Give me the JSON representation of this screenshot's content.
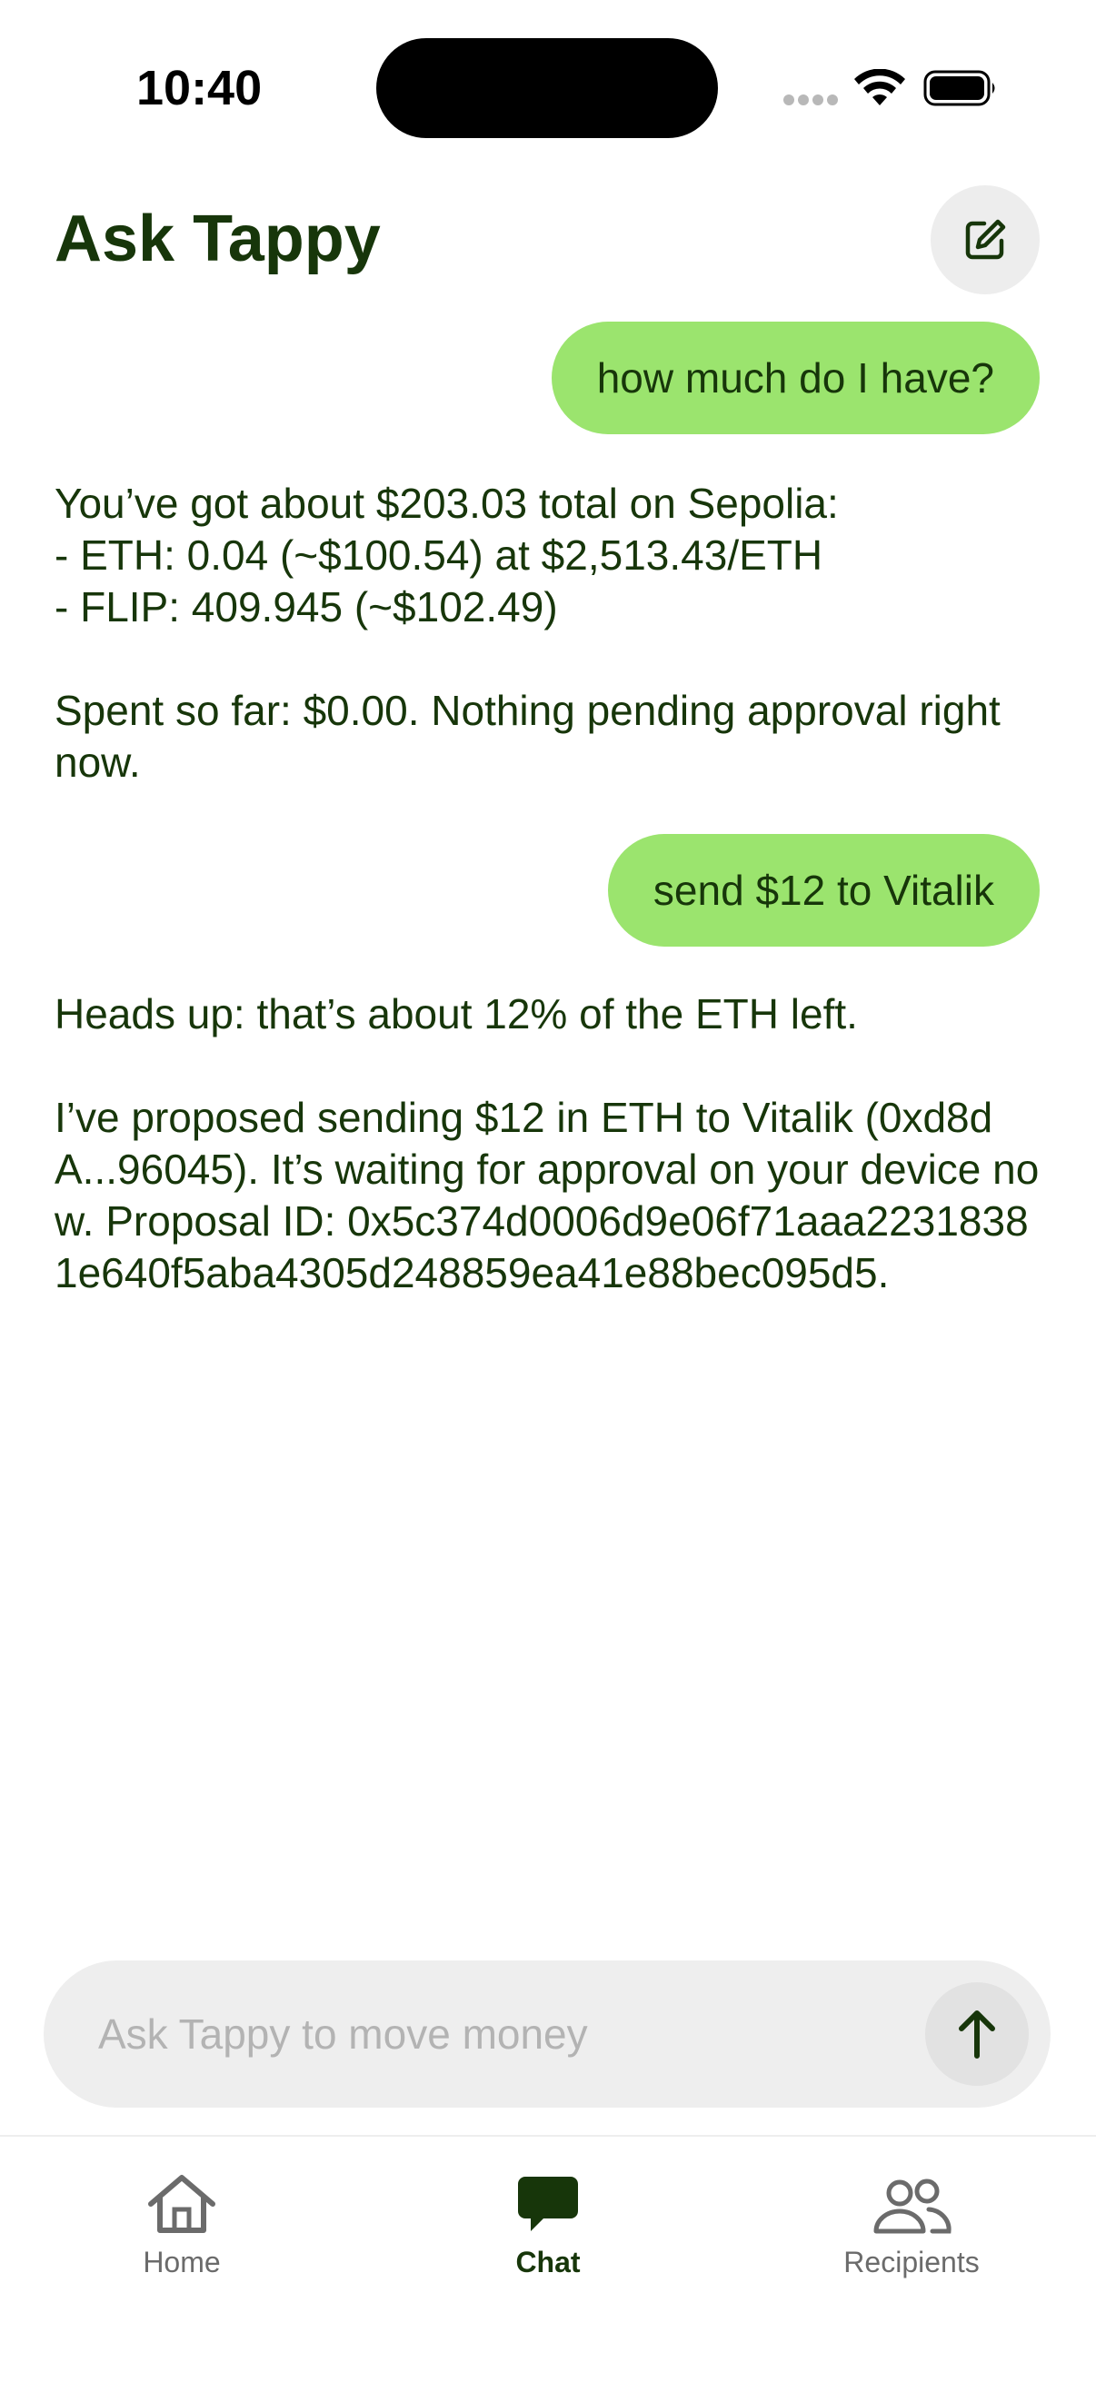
{
  "status_bar": {
    "time": "10:40"
  },
  "header": {
    "title": "Ask Tappy",
    "compose_icon": "compose-icon"
  },
  "messages": [
    {
      "role": "user",
      "text": "how much do I have?"
    },
    {
      "role": "assistant",
      "paragraphs": [
        "You’ve got about $203.03 total on Sepolia:\n- ETH: 0.04 (~$100.54) at $2,513.43/ETH\n- FLIP: 409.945 (~$102.49)",
        "Spent so far: $0.00. Nothing pending approval right now."
      ]
    },
    {
      "role": "user",
      "text": "send $12 to Vitalik"
    },
    {
      "role": "assistant",
      "paragraphs": [
        "Heads up: that’s about 12% of the ETH left.",
        "I’ve proposed sending $12 in ETH to Vitalik (0xd8dA...96045). It’s waiting for approval on your device now. Proposal ID: 0x5c374d0006d9e06f71aaa22318381e640f5aba4305d248859ea41e88bec095d5."
      ]
    }
  ],
  "composer": {
    "placeholder": "Ask Tappy to move money",
    "value": "",
    "send_icon": "arrow-up-icon"
  },
  "tab_bar": {
    "tabs": [
      {
        "label": "Home",
        "icon": "home-icon",
        "active": false
      },
      {
        "label": "Chat",
        "icon": "chat-bubble-icon",
        "active": true
      },
      {
        "label": "Recipients",
        "icon": "people-icon",
        "active": false
      }
    ]
  },
  "colors": {
    "user_bubble": "#9be46e",
    "text_dark_green": "#17360a",
    "input_background": "#eeeeee",
    "inactive_tab": "#6b6b6b"
  }
}
